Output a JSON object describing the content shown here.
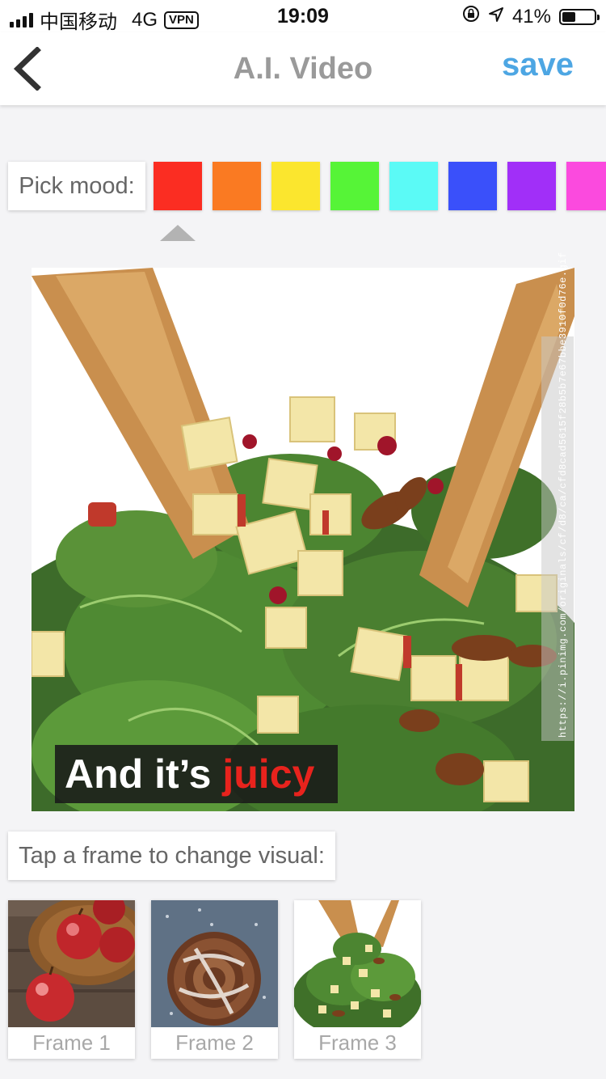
{
  "status_bar": {
    "carrier": "中国移动",
    "network": "4G",
    "vpn": "VPN",
    "time": "19:09",
    "battery_percent": "41%",
    "battery_level": 0.41
  },
  "nav": {
    "title": "A.I. Video",
    "save_label": "save",
    "back_icon": "chevron-left-icon"
  },
  "mood": {
    "label": "Pick mood:",
    "swatches": [
      "#fb2d22",
      "#fa7a22",
      "#fbe62e",
      "#56f437",
      "#5bfaf6",
      "#3a50fa",
      "#a12ff8",
      "#fb4ade"
    ],
    "selected_index": 0
  },
  "main_visual": {
    "caption_prefix": "And it’s ",
    "caption_highlight": "juicy",
    "highlight_color": "#e8231d",
    "watermark": "https://i.pinimg.com/originals/cf/d8/ca/cfd8cad5615f28b5b7e67bbe3910f0d76e.gif"
  },
  "frames": {
    "label": "Tap a frame to change visual:",
    "items": [
      {
        "label": "Frame 1"
      },
      {
        "label": "Frame 2"
      },
      {
        "label": "Frame 3"
      }
    ]
  }
}
